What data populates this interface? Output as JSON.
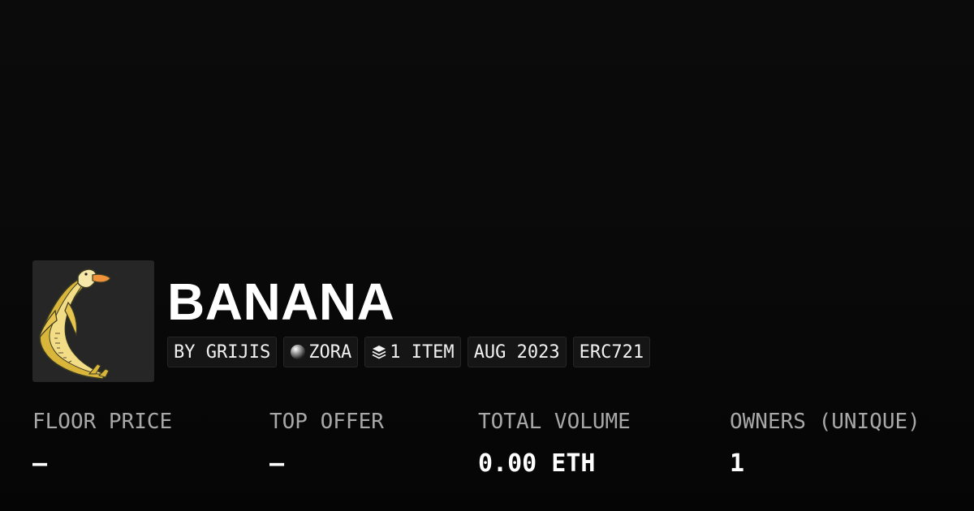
{
  "collection": {
    "name": "BANANA",
    "thumbnail_icon": "banana-duck-artwork"
  },
  "badges": {
    "creator": "BY GRIJIS",
    "chain": "ZORA",
    "chain_icon": "zora-orb-icon",
    "items": "1 ITEM",
    "items_icon": "layers-icon",
    "date": "AUG 2023",
    "standard": "ERC721"
  },
  "stats": {
    "floor_price": {
      "label": "FLOOR PRICE",
      "value": "–"
    },
    "top_offer": {
      "label": "TOP OFFER",
      "value": "–"
    },
    "total_volume": {
      "label": "TOTAL VOLUME",
      "value": "0.00 ETH"
    },
    "owners": {
      "label": "OWNERS (UNIQUE)",
      "value": "1"
    }
  },
  "colors": {
    "background": "#0a0a0a",
    "badge_bg": "#151515",
    "label": "#a8a8a8",
    "text": "#ffffff"
  }
}
